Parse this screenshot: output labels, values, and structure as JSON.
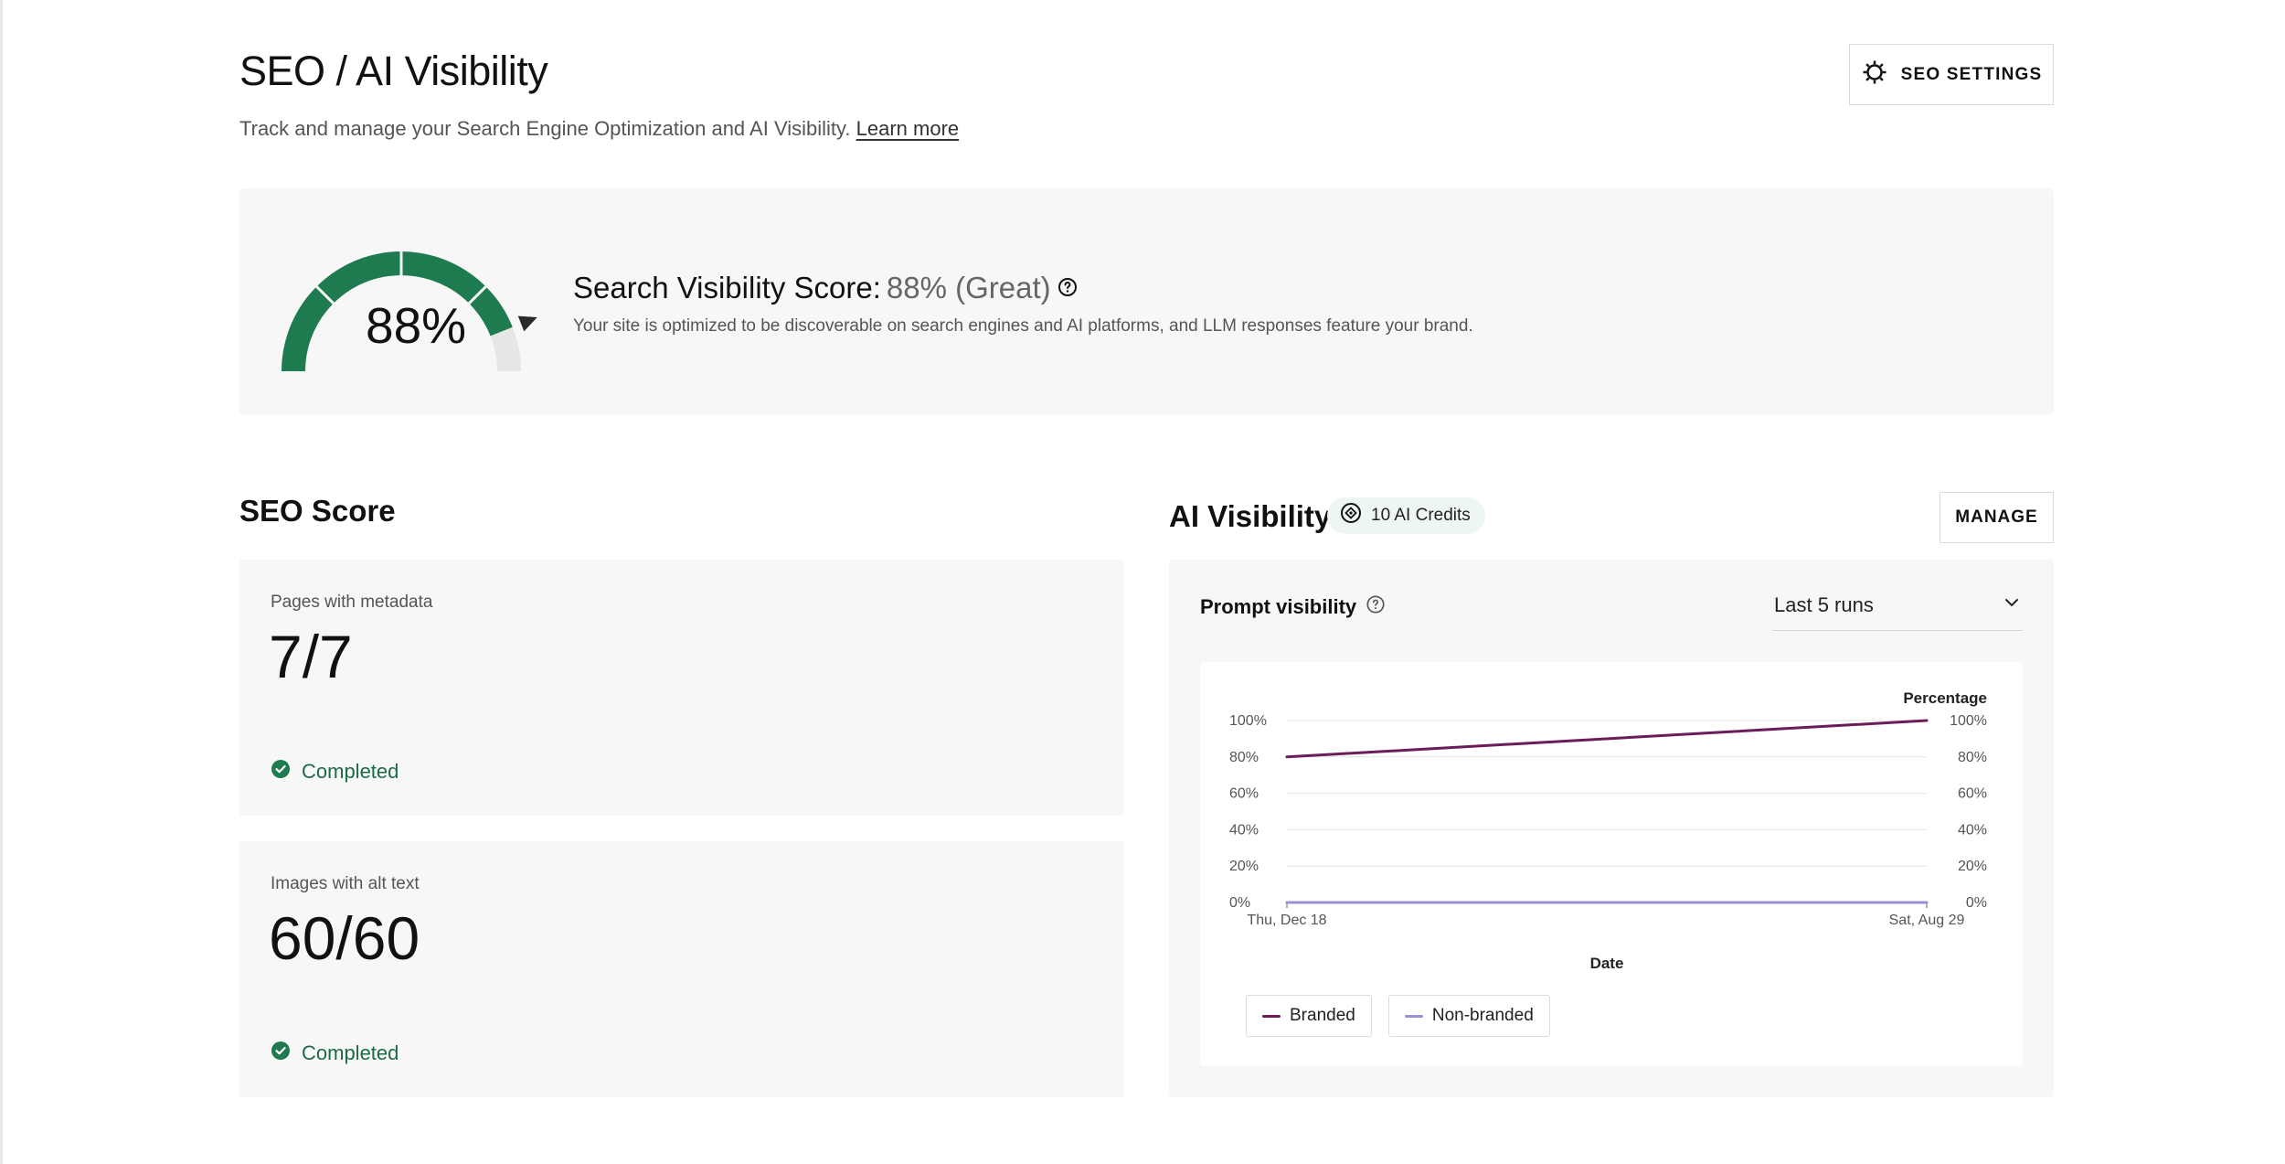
{
  "header": {
    "title": "SEO / AI Visibility",
    "subtitle": "Track and manage your Search Engine Optimization and AI Visibility.",
    "learn_more": "Learn more",
    "settings_button": "SEO SETTINGS"
  },
  "score": {
    "gauge_value": "88%",
    "gauge_fraction": 0.88,
    "heading_label": "Search Visibility Score:",
    "heading_value": "88% (Great)",
    "description": "Your site is optimized to be discoverable on search engines and AI platforms, and LLM responses feature your brand.",
    "colors": {
      "fill": "#1e7a4f",
      "track": "#e6e6e6",
      "marker": "#2a2a2a"
    }
  },
  "seo": {
    "title": "SEO Score",
    "metrics": [
      {
        "label": "Pages with metadata",
        "value": "7/7",
        "status": "Completed"
      },
      {
        "label": "Images with alt text",
        "value": "60/60",
        "status": "Completed"
      }
    ]
  },
  "ai": {
    "title": "AI Visibility",
    "credits": "10 AI Credits",
    "manage_button": "MANAGE",
    "prompt_label": "Prompt visibility",
    "runs_select": "Last 5 runs"
  },
  "chart_data": {
    "type": "line",
    "x": [
      "Thu, Dec 18",
      "Sat, Aug 29"
    ],
    "xlabel": "Date",
    "ylabel": "Percentage",
    "ylim": [
      0,
      100
    ],
    "y_ticks": [
      "0%",
      "20%",
      "40%",
      "60%",
      "80%",
      "100%"
    ],
    "grid": true,
    "series": [
      {
        "name": "Branded",
        "values": [
          80,
          100
        ],
        "color": "#6b1d5a"
      },
      {
        "name": "Non-branded",
        "values": [
          0,
          0
        ],
        "color": "#9c8fd6"
      }
    ],
    "legend_position": "bottom-left"
  }
}
